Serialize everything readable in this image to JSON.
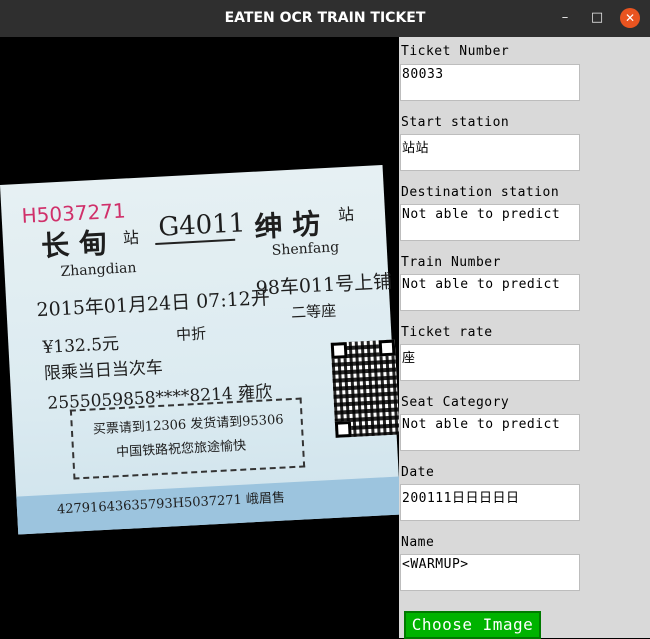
{
  "window": {
    "title": "EATEN OCR TRAIN TICKET",
    "min_glyph": "–",
    "max_glyph": "□",
    "close_glyph": "✕"
  },
  "ticket_image": {
    "serial": "H5037271",
    "from_station": "长 甸",
    "from_suffix": "站",
    "from_pinyin": "Zhangdian",
    "train": "G4011",
    "to_station": "绅 坊",
    "to_suffix": "站",
    "to_pinyin": "Shenfang",
    "date_line": "2015年01月24日 07:12开",
    "car_seat": "98车011号上铺",
    "seat_class": "二等座",
    "discount": "中折",
    "price": "¥132.5元",
    "validity": "限乘当日当次车",
    "id_line": "2555059858****8214 雍欣",
    "notice1": "买票请到12306 发货请到95306",
    "notice2": "中国铁路祝您旅途愉快",
    "bottom_code": "42791643635793H5037271 峨眉售"
  },
  "form": {
    "ticket_number": {
      "label": "Ticket Number",
      "value": "80033"
    },
    "start_station": {
      "label": "Start station",
      "value": "站站"
    },
    "destination_station": {
      "label": "Destination station",
      "value": "Not able to predict"
    },
    "train_number": {
      "label": "Train Number",
      "value": "Not able to predict"
    },
    "ticket_rate": {
      "label": "Ticket rate",
      "value": "座"
    },
    "seat_category": {
      "label": "Seat Category",
      "value": "Not able to predict"
    },
    "date": {
      "label": "Date",
      "value": "200111日日日日日"
    },
    "name": {
      "label": "Name",
      "value": "<WARMUP>"
    }
  },
  "choose_button": {
    "label": "Choose Image"
  },
  "colors": {
    "titlebar": "#2f2f2f",
    "close_button": "#e95420",
    "panel": "#d9d9d9",
    "choose_button": "#00b300",
    "serial_text": "#d0306a"
  }
}
